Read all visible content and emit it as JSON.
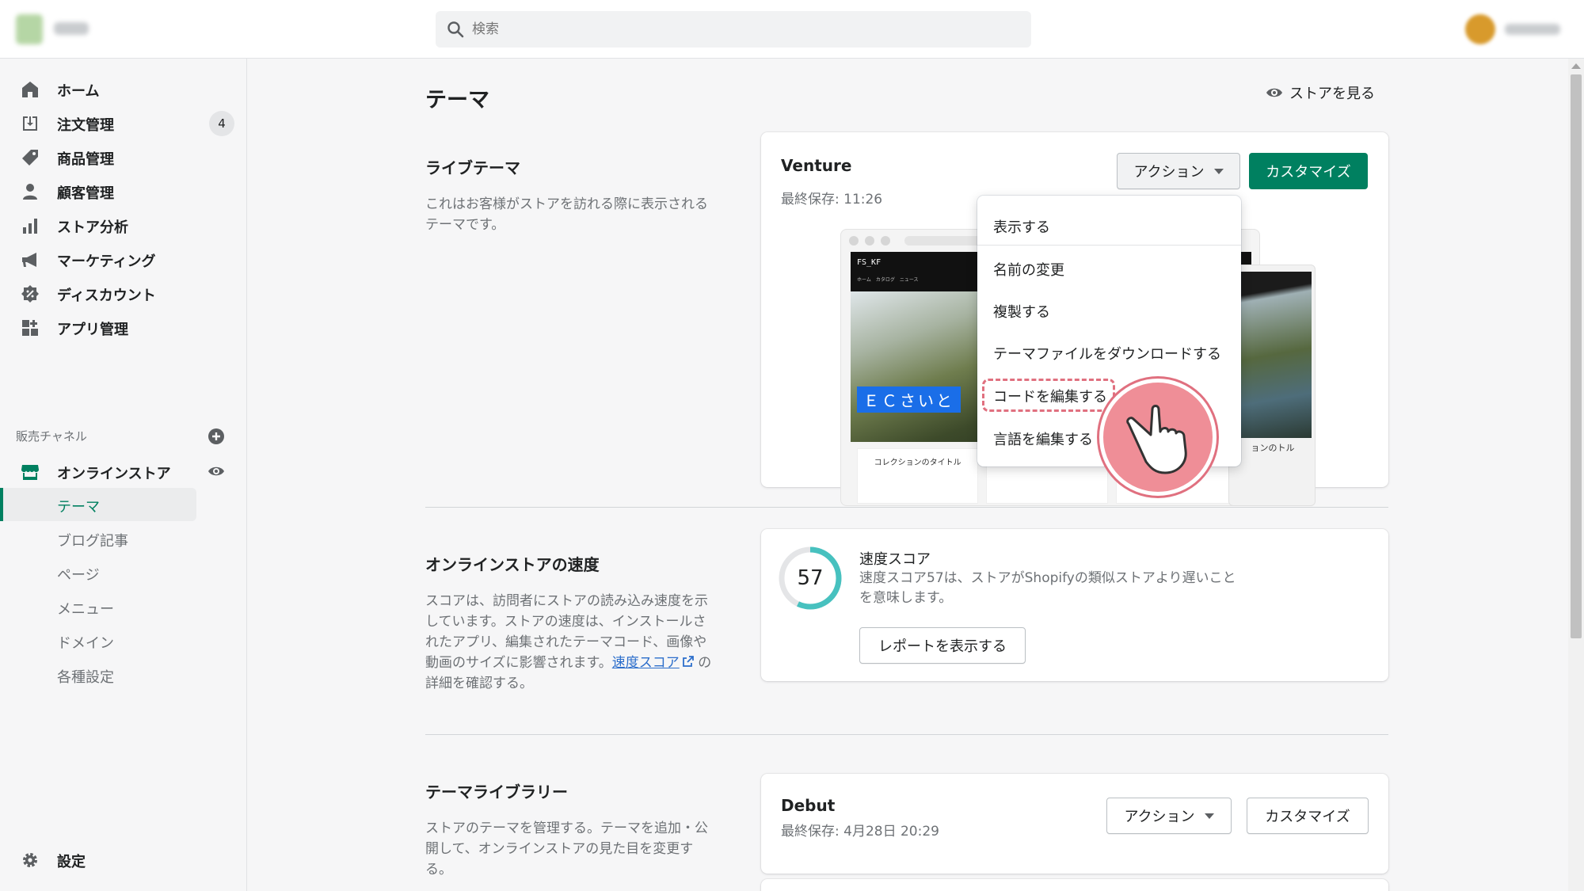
{
  "topbar": {
    "search_placeholder": "検索"
  },
  "sidebar": {
    "items": [
      {
        "label": "ホーム",
        "icon": "home-icon"
      },
      {
        "label": "注文管理",
        "icon": "orders-icon",
        "badge": "4"
      },
      {
        "label": "商品管理",
        "icon": "tag-icon"
      },
      {
        "label": "顧客管理",
        "icon": "person-icon"
      },
      {
        "label": "ストア分析",
        "icon": "analytics-icon"
      },
      {
        "label": "マーケティング",
        "icon": "megaphone-icon"
      },
      {
        "label": "ディスカウント",
        "icon": "discount-icon"
      },
      {
        "label": "アプリ管理",
        "icon": "apps-icon"
      }
    ],
    "channels_label": "販売チャネル",
    "online_store": "オンラインストア",
    "sub_items": [
      "テーマ",
      "ブログ記事",
      "ページ",
      "メニュー",
      "ドメイン",
      "各種設定"
    ],
    "settings": "設定"
  },
  "main": {
    "title": "テーマ",
    "view_store": "ストアを見る",
    "live_theme": {
      "heading": "ライブテーマ",
      "description": "これはお客様がストアを訪れる際に表示されるテーマです。",
      "theme_name": "Venture",
      "last_saved": "最終保存: 11:26",
      "actions_label": "アクション",
      "customize_label": "カスタマイズ",
      "preview": {
        "brand": "FS_KF",
        "nav": "ホーム　カタログ　ニュース",
        "banner": "ＥＣさいと",
        "card1": "コレクションのタイトル",
        "mobile_text": "ョンのトル"
      }
    },
    "actions_menu": [
      "表示する",
      "名前の変更",
      "複製する",
      "テーマファイルをダウンロードする",
      "コードを編集する",
      "言語を編集する"
    ],
    "speed": {
      "heading": "オンラインストアの速度",
      "description": "スコアは、訪問者にストアの読み込み速度を示しています。ストアの速度は、インストールされたアプリ、編集されたテーマコード、画像や動画のサイズに影響されます。",
      "link": "速度スコア",
      "description_tail": " の詳細を確認する。",
      "score": "57",
      "score_value": 57,
      "title": "速度スコア",
      "text": "速度スコア57は、ストアがShopifyの類似ストアより遅いことを意味します。",
      "report_button": "レポートを表示する"
    },
    "library": {
      "heading": "テーマライブラリー",
      "description": "ストアのテーマを管理する。テーマを追加・公開して、オンラインストアの見た目を変更する。",
      "theme_name": "Debut",
      "last_saved": "最終保存: 4月28日 20:29",
      "actions_label": "アクション",
      "customize_label": "カスタマイズ"
    }
  },
  "colors": {
    "primary": "#008060",
    "link": "#2c6ecb",
    "highlight": "#e0707f",
    "score_ring": "#47c1bf"
  }
}
